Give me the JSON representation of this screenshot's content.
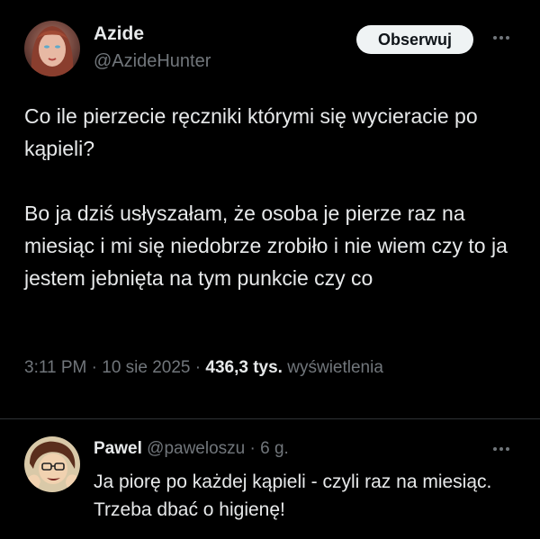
{
  "tweet": {
    "author": {
      "name": "Azide",
      "handle": "@AzideHunter"
    },
    "follow_label": "Obserwuj",
    "more_icon": "more-horizontal-icon",
    "text_paragraphs": [
      "Co ile pierzecie ręczniki którymi się wycieracie po kąpieli?",
      "Bo ja dziś usłyszałam, że osoba je pierze raz na miesiąc i mi się niedobrze zrobiło i nie wiem czy to ja jestem jebnięta na tym punkcie czy co"
    ],
    "time": "3:11 PM",
    "date": "10 sie 2025",
    "separator": "·",
    "views_count": "436,3 tys.",
    "views_label": "wyświetlenia"
  },
  "reply": {
    "author": {
      "name": "Pawel",
      "handle": "@paweloszu"
    },
    "separator": "·",
    "time_ago": "6 g.",
    "more_icon": "more-horizontal-icon",
    "text": "Ja piorę po każdej kąpieli - czyli raz na miesiąc. Trzeba dbać o higienę!"
  },
  "colors": {
    "background": "#000000",
    "primary_text": "#e7e9ea",
    "secondary_text": "#71767b",
    "button_bg": "#eff3f4",
    "button_text": "#0f1419",
    "divider": "#2f3336"
  }
}
